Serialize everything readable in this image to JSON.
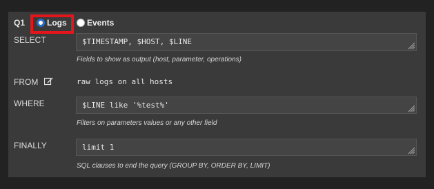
{
  "query": {
    "id_label": "Q1",
    "radio_logs": "Logs",
    "radio_events": "Events",
    "selected": "Logs"
  },
  "select": {
    "label": "SELECT",
    "value": "$TIMESTAMP, $HOST, $LINE",
    "hint": "Fields to show as output (host, parameter, operations)"
  },
  "from": {
    "label": "FROM",
    "value": "raw logs on all hosts",
    "icon": "edit-icon"
  },
  "where": {
    "label": "WHERE",
    "value": "$LINE like '%test%'",
    "hint": "Filters on parameters values or any other field"
  },
  "finally": {
    "label": "FINALLY",
    "value": "limit 1",
    "hint": "SQL clauses to end the query (GROUP BY, ORDER BY, LIMIT)"
  },
  "colors": {
    "background": "#222222",
    "panel": "#3a3a3a",
    "field": "#444444",
    "highlight": "#e4161b",
    "radio_selected": "#2a6cc4"
  }
}
